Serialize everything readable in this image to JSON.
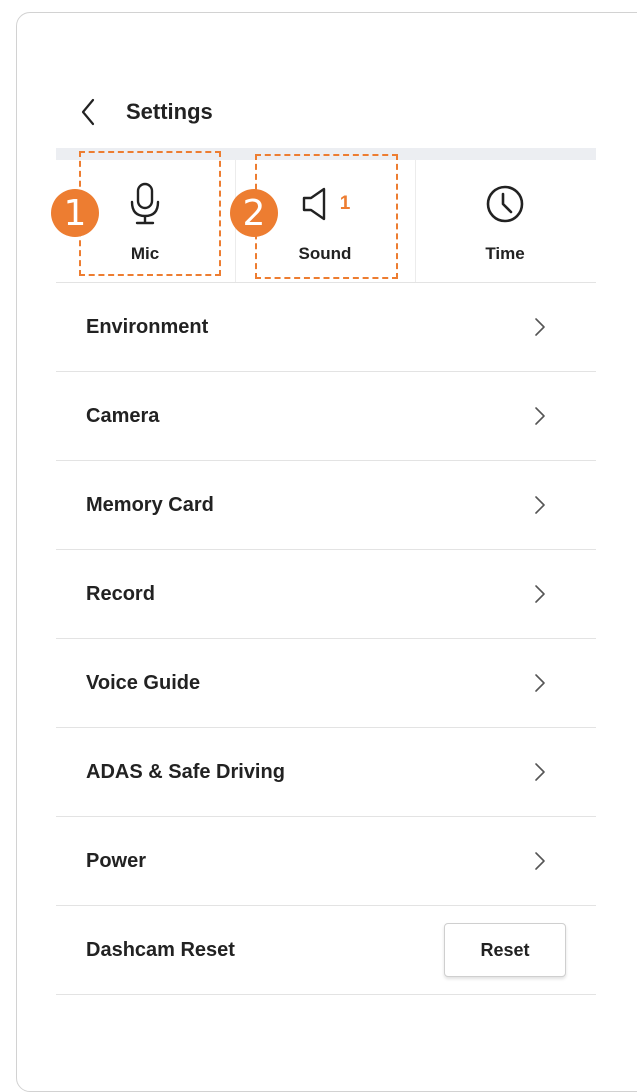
{
  "header": {
    "title": "Settings"
  },
  "tabs": [
    {
      "label": "Mic",
      "icon": "microphone-icon"
    },
    {
      "label": "Sound",
      "icon": "speaker-icon",
      "count": "1"
    },
    {
      "label": "Time",
      "icon": "clock-icon"
    }
  ],
  "annotations": [
    {
      "number": "1"
    },
    {
      "number": "2"
    }
  ],
  "menu": {
    "items": [
      {
        "label": "Environment"
      },
      {
        "label": "Camera"
      },
      {
        "label": "Memory Card"
      },
      {
        "label": "Record"
      },
      {
        "label": "Voice Guide"
      },
      {
        "label": "ADAS & Safe Driving"
      },
      {
        "label": "Power"
      }
    ],
    "reset_row": {
      "label": "Dashcam Reset",
      "button_label": "Reset"
    }
  },
  "colors": {
    "accent": "#ed7d31",
    "divider": "#e3e3e3"
  }
}
